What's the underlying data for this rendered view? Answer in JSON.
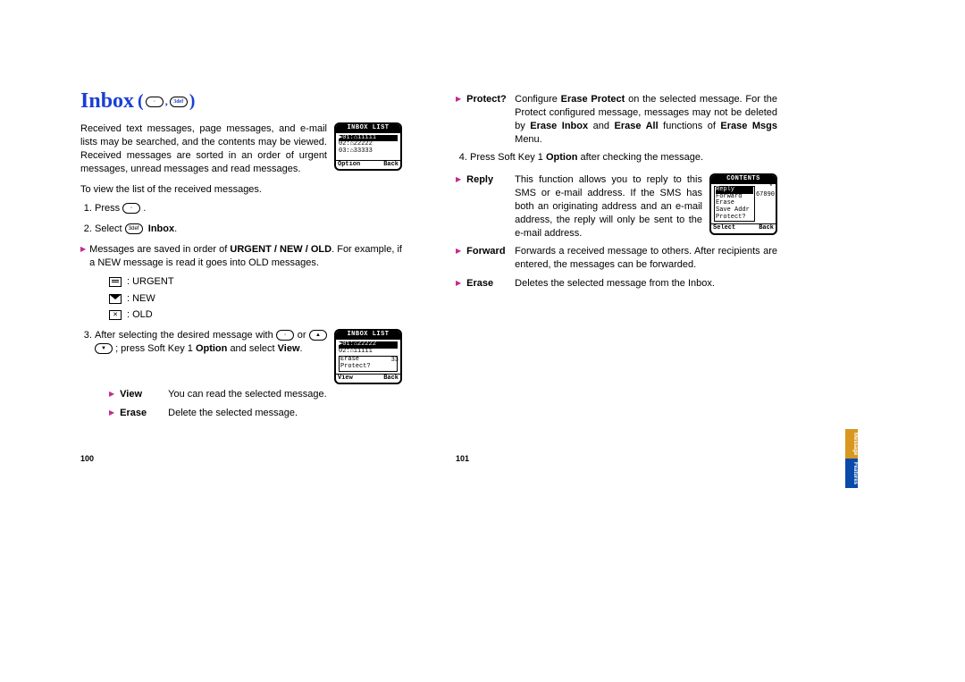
{
  "title": "Inbox",
  "intro": "Received text messages, page messages, and e-mail lists may be searched, and the contents may be viewed. Received messages are sorted in an order of urgent messages, unread messages and read messages.",
  "left": {
    "lead": "To view the list of the received messages.",
    "step1_pre": "Press ",
    "step1_post": " .",
    "step2_pre": "Select ",
    "step2_label": "Inbox",
    "step2_post": ".",
    "note_pre": "Messages are saved in order of ",
    "note_bold": "URGENT / NEW / OLD",
    "note_post": ". For example, if a NEW message is read it goes into OLD messages.",
    "icon_urgent": ": URGENT",
    "icon_new": ": NEW",
    "icon_old": ": OLD",
    "step3_a": "After selecting the desired message with ",
    "step3_b": " or ",
    "step3_c": " ; press Soft Key 1 ",
    "step3_bold": "Option",
    "step3_d": " and select ",
    "step3_bold2": "View",
    "step3_e": ".",
    "view_lbl": "View",
    "view_txt": "You can read the selected message.",
    "erase_lbl": "Erase",
    "erase_txt": "Delete the selected message."
  },
  "right": {
    "protect_lbl": "Protect?",
    "protect_a": "Configure ",
    "protect_b1": "Erase Protect",
    "protect_c": " on the selected message. For the Protect configured message, messages may not be deleted by ",
    "protect_b2": "Erase Inbox",
    "protect_d": " and ",
    "protect_b3": "Erase All",
    "protect_e": " functions of ",
    "protect_b4": "Erase Msgs",
    "protect_f": " Menu.",
    "step4_a": "Press Soft Key 1 ",
    "step4_b": "Option",
    "step4_c": " after checking the message.",
    "reply_lbl": "Reply",
    "reply_txt": "This function allows you to reply to this SMS or e-mail address. If the SMS has both an originating address and an e-mail address, the reply will only be sent to the e-mail address.",
    "forward_lbl": "Forward",
    "forward_txt": "Forwards a received message to others. After recipients are entered, the messages can be forwarded.",
    "erase_lbl": "Erase",
    "erase_txt": "Deletes the selected message from the Inbox."
  },
  "screens": {
    "s1": {
      "hdr": "INBOX LIST",
      "r1": "▶01:⌂11111",
      "r2": " 02:⌂22222",
      "r3": " 03:⌂33333",
      "fl": "Option",
      "fr": "Back"
    },
    "s2": {
      "hdr": "INBOX LIST",
      "r1": "▶01:⌂22222",
      "r2": " 02:⌂11111",
      "r3a": "Erase",
      "r3b": "Protect?",
      "fl": "View",
      "fr": "Back",
      "tail": "33"
    },
    "s3": {
      "hdr": "CONTENTS",
      "r1": "Reply",
      "r2": "Forward",
      "r3": "Erase",
      "r4": "Save Addr",
      "r5": "Protect?",
      "fl": "Select",
      "fr": "Back",
      "side1": "*",
      "side2": "67890"
    }
  },
  "pages": {
    "left": "100",
    "right": "101"
  },
  "tab": {
    "t1": "Message",
    "t2": "Features"
  }
}
